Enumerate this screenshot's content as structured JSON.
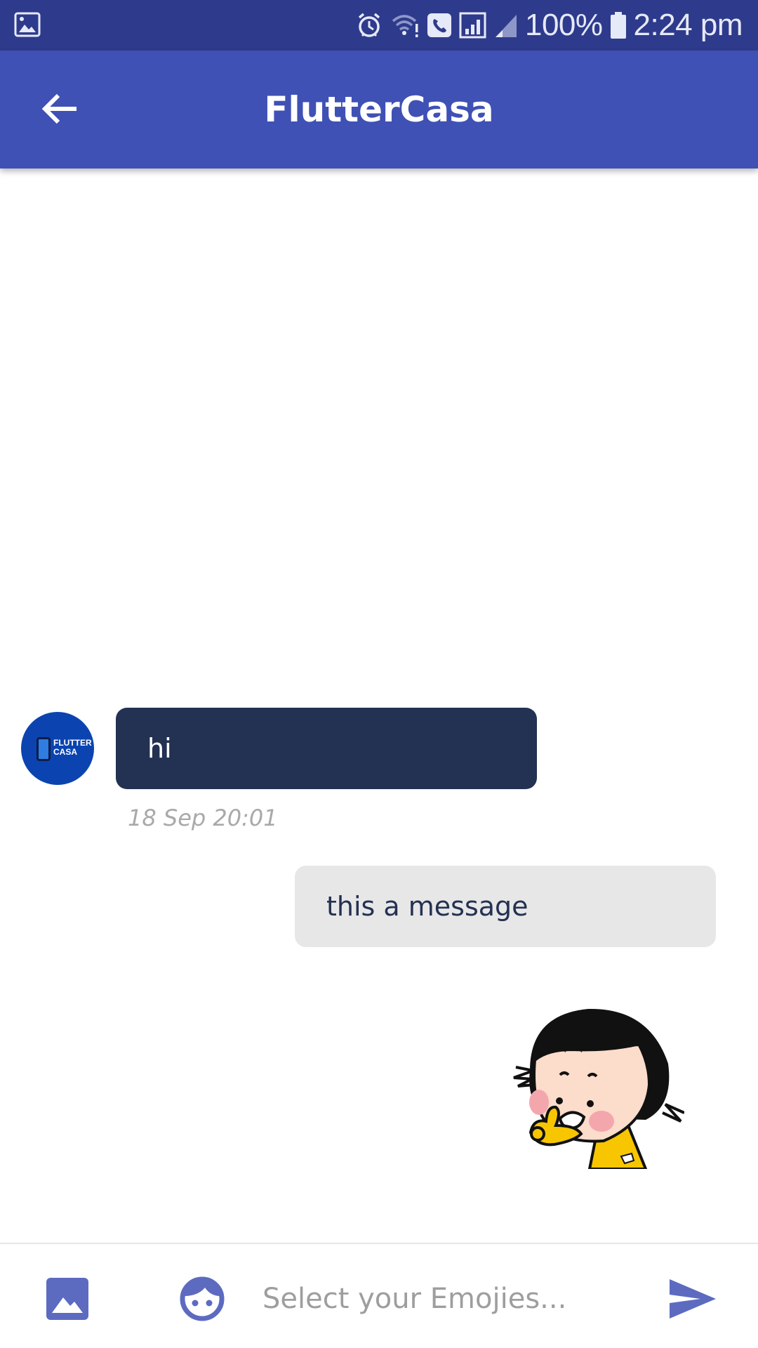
{
  "status_bar": {
    "battery": "100%",
    "time": "2:24 pm"
  },
  "app_bar": {
    "title": "FlutterCasa",
    "back_icon": "arrow-back-icon"
  },
  "messages": [
    {
      "direction": "incoming",
      "text": "hi",
      "time": "18 Sep 20:01",
      "avatar_text": "FLUTTER CASA"
    },
    {
      "direction": "outgoing",
      "text": "this a message"
    },
    {
      "direction": "outgoing",
      "type": "sticker",
      "sticker": "girl-thumbs-up-sticker"
    }
  ],
  "input_bar": {
    "placeholder": "Select your Emojies...",
    "value": "",
    "icons": [
      "image-icon",
      "emoji-face-icon",
      "send-icon"
    ]
  },
  "colors": {
    "status_bar": "#2e3b8c",
    "app_bar": "#3f51b5",
    "incoming_bubble": "#233152",
    "outgoing_bubble": "#e7e7e7",
    "accent_icons": "#5c6bc0"
  }
}
